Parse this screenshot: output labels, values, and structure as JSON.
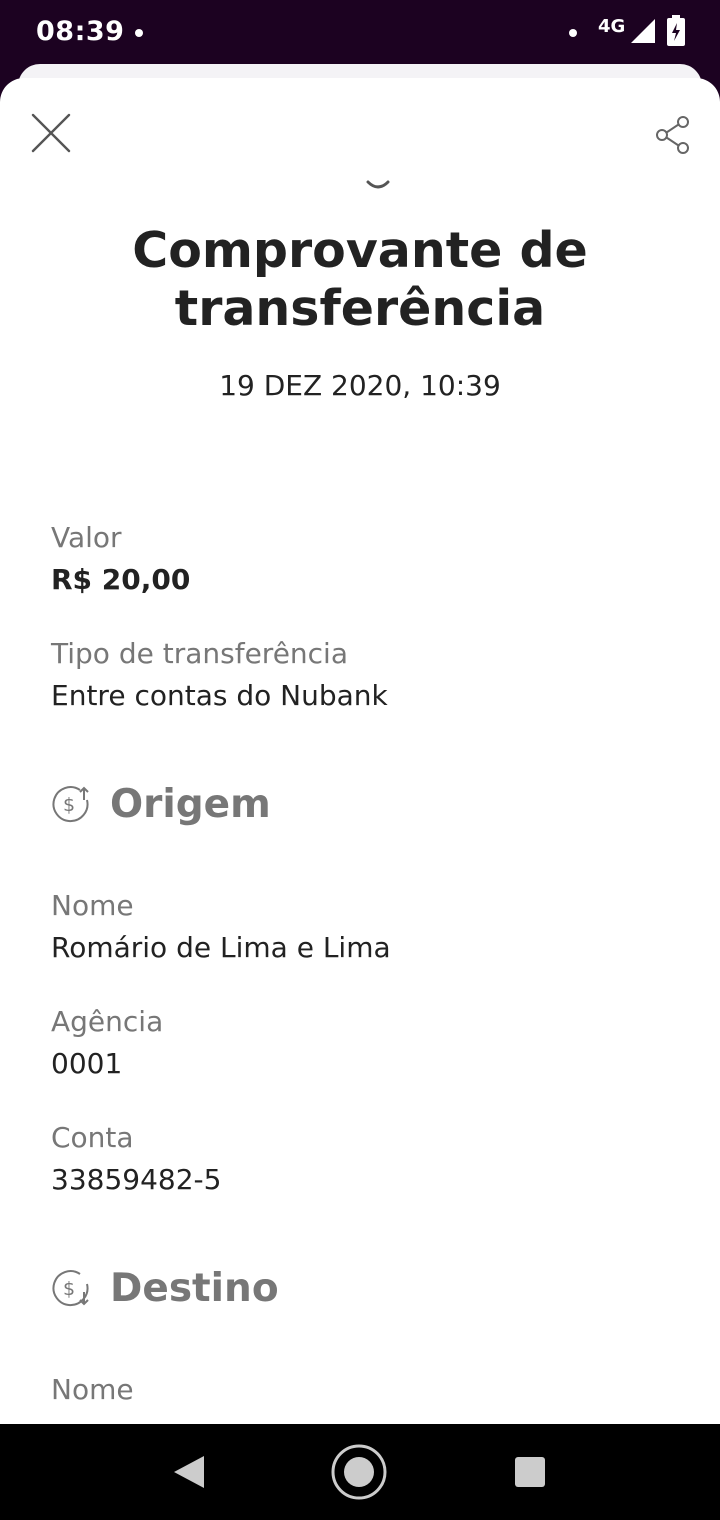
{
  "status_bar": {
    "time": "08:39",
    "network": "4G"
  },
  "header": {
    "close_icon": "close-icon",
    "share_icon": "share-icon"
  },
  "receipt": {
    "title": "Comprovante de transferência",
    "date": "19 DEZ 2020, 10:39",
    "fields": [
      {
        "label": "Valor",
        "value": "R$ 20,00"
      },
      {
        "label": "Tipo de transferência",
        "value": "Entre contas do Nubank"
      }
    ]
  },
  "origin": {
    "title": "Origem",
    "icon": "dollar-up-arrow-icon",
    "fields": [
      {
        "label": "Nome",
        "value": "Romário de Lima e Lima"
      },
      {
        "label": "Agência",
        "value": "0001"
      },
      {
        "label": "Conta",
        "value": "33859482-5"
      }
    ]
  },
  "destination": {
    "title": "Destino",
    "icon": "dollar-down-arrow-icon",
    "fields": [
      {
        "label": "Nome",
        "value": ""
      }
    ]
  },
  "nav_bar": {
    "back_icon": "back-triangle-icon",
    "home_icon": "home-circle-icon",
    "recents_icon": "recents-square-icon"
  },
  "colors": {
    "status_bar": "#1c0221",
    "title_text": "#222222",
    "label_text": "#777777"
  }
}
